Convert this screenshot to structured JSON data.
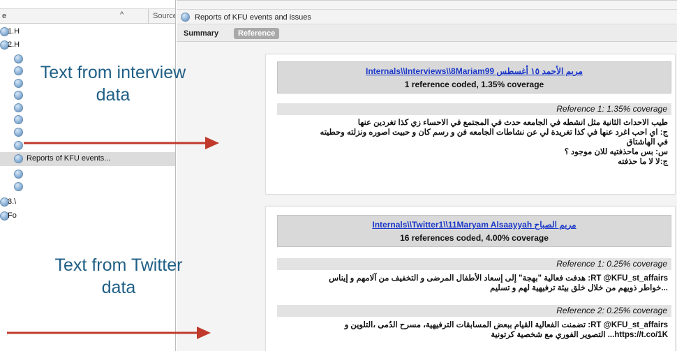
{
  "left_pane": {
    "header": {
      "name_col": "e",
      "sort_indicator": "^",
      "source_col": "Source"
    },
    "tree": [
      {
        "label": "1.H",
        "indent": 0,
        "icon": "folder-node-icon"
      },
      {
        "label": "2.H",
        "indent": 0,
        "icon": "folder-node-icon"
      },
      {
        "label": "",
        "indent": 1,
        "icon": "case-node-icon"
      },
      {
        "label": "",
        "indent": 1,
        "icon": "case-node-icon"
      },
      {
        "label": "",
        "indent": 1,
        "icon": "case-node-icon"
      },
      {
        "label": "",
        "indent": 1,
        "icon": "case-node-icon"
      },
      {
        "label": "",
        "indent": 1,
        "icon": "case-node-icon"
      },
      {
        "label": "",
        "indent": 1,
        "icon": "case-node-icon"
      },
      {
        "label": "",
        "indent": 1,
        "icon": "case-node-icon"
      },
      {
        "label": "",
        "indent": 1,
        "icon": "case-node-icon"
      },
      {
        "label": "Reports of KFU events...",
        "indent": 1,
        "icon": "case-node-icon",
        "selected": true
      },
      {
        "label": "",
        "indent": 1,
        "icon": "case-node-icon"
      },
      {
        "label": "",
        "indent": 1,
        "icon": "case-node-icon"
      },
      {
        "label": "3.\\",
        "indent": 0,
        "icon": "folder-node-icon"
      },
      {
        "label": "Fo",
        "indent": 0,
        "icon": "folder-node-icon"
      }
    ]
  },
  "right_pane": {
    "title": "Reports of KFU events and issues",
    "tabs": {
      "summary": "Summary",
      "reference": "Reference"
    },
    "cards": [
      {
        "source_link": "Internals\\\\Interviews\\\\8Mariam99 مريم الأحمد ١٥ أغسطس",
        "coverage": "1 reference coded, 1.35% coverage",
        "references": [
          {
            "header": "Reference 1: 1.35% coverage",
            "lines": [
              "طيب الاحداث الثانية مثل انشطه في الجامعه حدث في المجتمع في الاحساء زي كذا تغردين عنها",
              "ج: اي احب اغرد عنها في كذا تغريدة لي عن نشاطات الجامعه فن و رسم كان و حبيت اصوره ونزلته وحطيته",
              "في الهاشتاق",
              "س: بس ماحذفتيه للان موجود ؟",
              "ج:لا لا ما حذفته"
            ]
          }
        ]
      },
      {
        "source_link": "Internals\\\\Twitter1\\\\11Maryam Alsaayyah مريم الصباح",
        "coverage": "16 references coded, 4.00% coverage",
        "references": [
          {
            "header": "Reference 1: 0.25% coverage",
            "lines": [
              "RT @KFU_st_affairs: هدفت فعالية \"بهجة\" إلى إسعاد الأطفال المرضى و التخفيف من آلامهم و إيناس",
              "...خواطر ذويهم من خلال خلق بيئة ترفيهية لهم و تسليم"
            ]
          },
          {
            "header": "Reference 2: 0.25% coverage",
            "lines": [
              "RT @KFU_st_affairs: تضمنت الفعالية القيام ببعض المسابقات الترفيهية، مسرح الدُمى ،التلوين و",
              "https://t.co/1K... التصوير الفوري مع شخصية كرتونية"
            ]
          }
        ]
      }
    ]
  },
  "annotations": {
    "interview_label_line1": "Text from interview",
    "interview_label_line2": "data",
    "twitter_label_line1": "Text from Twitter",
    "twitter_label_line2": "data",
    "arrow_color": "#c0392b",
    "text_color": "#1f5f86"
  }
}
